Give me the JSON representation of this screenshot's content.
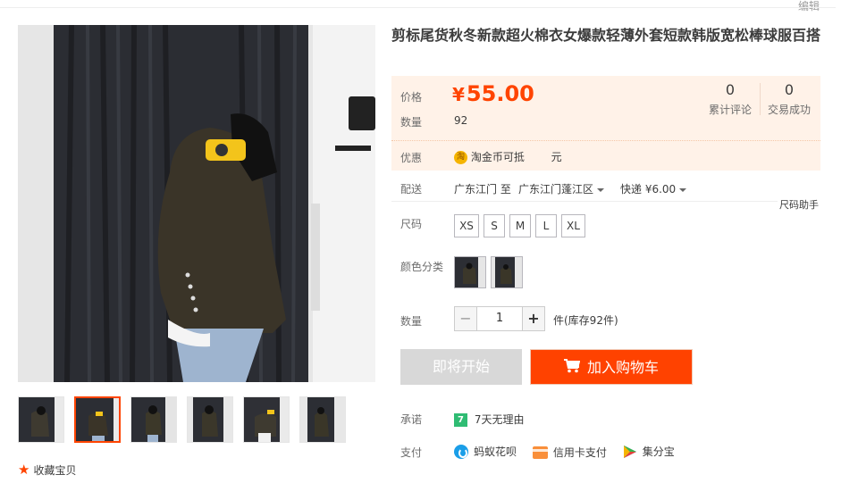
{
  "header": {
    "edit_label": "编辑"
  },
  "gallery": {
    "thumbnail_count": 6,
    "active_thumbnail": 2,
    "favorite_label": "收藏宝贝"
  },
  "product": {
    "title": "剪标尾货秋冬新款超火棉衣女爆款轻薄外套短款韩版宽松棒球服百搭",
    "price_label": "价格",
    "currency": "¥",
    "price": "55.00",
    "quantity_label": "数量",
    "quantity_sold": "92",
    "reviews_count": "0",
    "reviews_label": "累计评论",
    "transactions_count": "0",
    "transactions_label": "交易成功",
    "promo_label": "优惠",
    "promo_coin_icon": "淘",
    "promo_text": "淘金币可抵",
    "promo_unit": "元"
  },
  "shipping": {
    "label": "配送",
    "from": "广东江门 至",
    "to": "广东江门蓬江区",
    "method": "快递 ¥6.00",
    "size_helper": "尺码助手"
  },
  "sizes": {
    "label": "尺码",
    "options": [
      "XS",
      "S",
      "M",
      "L",
      "XL"
    ]
  },
  "colors": {
    "label": "颜色分类",
    "swatch_count": 2
  },
  "quantity": {
    "label": "数量",
    "minus": "−",
    "value": "1",
    "plus": "+",
    "stock_text": "件(库存92件)"
  },
  "actions": {
    "buy_now": "即将开始",
    "add_to_cart": "加入购物车"
  },
  "promise": {
    "label": "承诺",
    "badge": "7",
    "text": "7天无理由"
  },
  "payment": {
    "label": "支付",
    "methods": [
      "蚂蚁花呗",
      "信用卡支付",
      "集分宝"
    ]
  },
  "colors_palette": {
    "accent": "#ff4400",
    "price_bg": "#fff2e8",
    "disabled_btn": "#d8d8d8"
  }
}
